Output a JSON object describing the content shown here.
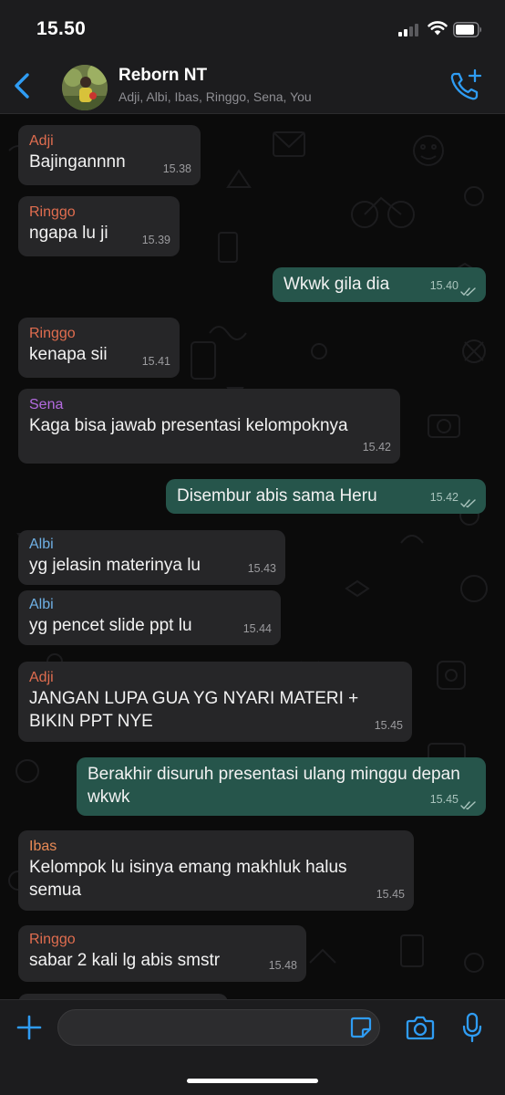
{
  "status_bar": {
    "time": "15.50"
  },
  "header": {
    "group_name": "Reborn NT",
    "members": "Adji, Albi, Ibas, Ringgo, Sena, You"
  },
  "colors": {
    "accent": "#2f9cf3",
    "incoming_bubble": "#262628",
    "outgoing_bubble": "#26554b",
    "sender_adji": "#e06d4f",
    "sender_ringgo": "#e06d4f",
    "sender_sena": "#b46be0",
    "sender_albi": "#6fb0e5",
    "sender_ibas": "#e98a55"
  },
  "messages": [
    {
      "type": "in",
      "sender": "Adji",
      "text": "Bajingannnn",
      "time": "15.38"
    },
    {
      "type": "in",
      "sender": "Ringgo",
      "text": "ngapa lu ji",
      "time": "15.39"
    },
    {
      "type": "out",
      "text": "Wkwk gila dia",
      "time": "15.40"
    },
    {
      "type": "in",
      "sender": "Ringgo",
      "text": "kenapa sii",
      "time": "15.41"
    },
    {
      "type": "in",
      "sender": "Sena",
      "text": "Kaga bisa jawab presentasi kelompoknya",
      "time": "15.42"
    },
    {
      "type": "out",
      "text": "Disembur abis sama Heru",
      "time": "15.42"
    },
    {
      "type": "in",
      "sender": "Albi",
      "text": "yg jelasin materinya lu",
      "time": "15.43"
    },
    {
      "type": "in",
      "sender": "Albi",
      "text": "yg pencet slide ppt lu",
      "time": "15.44"
    },
    {
      "type": "in",
      "sender": "Adji",
      "text": "JANGAN LUPA GUA YG NYARI MATERI + BIKIN PPT NYE",
      "time": "15.45"
    },
    {
      "type": "out",
      "text": "Berakhir disuruh presentasi ulang minggu depan wkwk",
      "time": "15.45"
    },
    {
      "type": "in",
      "sender": "Ibas",
      "text": "Kelompok lu isinya emang makhluk halus semua",
      "time": "15.45"
    },
    {
      "type": "in",
      "sender": "Ringgo",
      "text": "sabar 2 kali lg abis smstr",
      "time": "15.48"
    }
  ],
  "icons": {
    "back": "chevron-left-icon",
    "add_call": "phone-plus-icon",
    "attach": "plus-icon",
    "sticker": "sticker-icon",
    "camera": "camera-icon",
    "mic": "microphone-icon"
  },
  "composer": {
    "value": "",
    "placeholder": ""
  }
}
